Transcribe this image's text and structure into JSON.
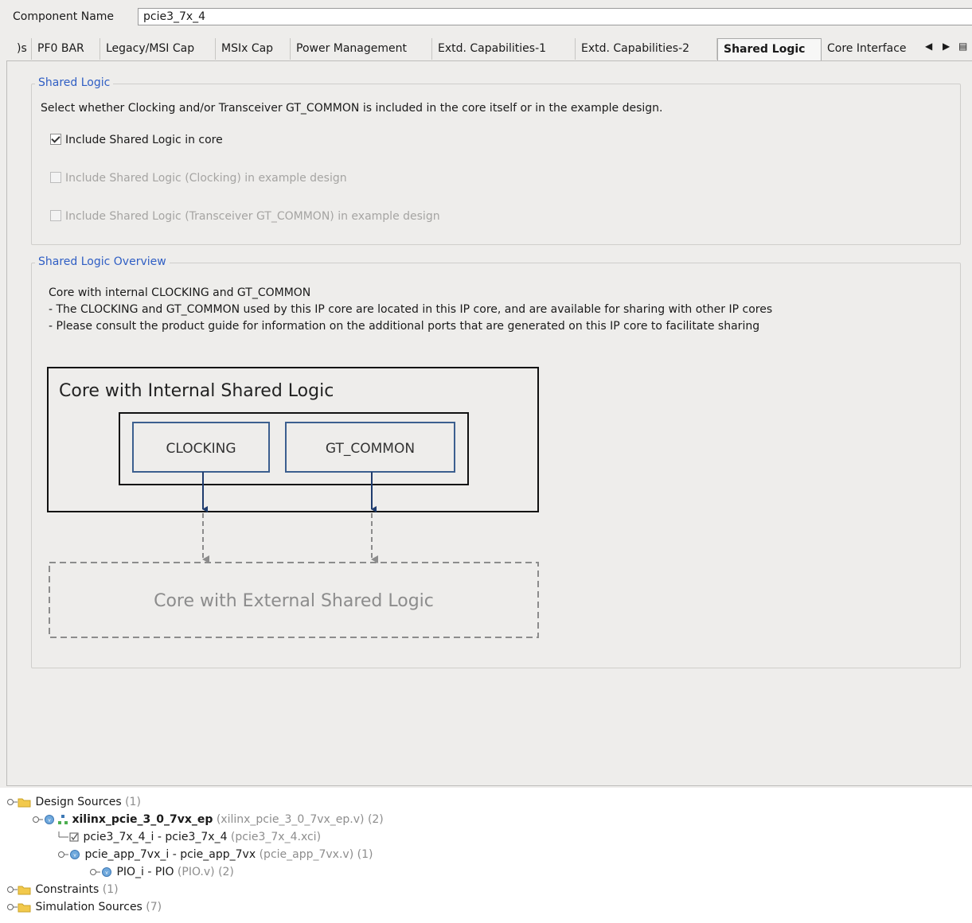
{
  "component": {
    "label": "Component Name",
    "value": "pcie3_7x_4"
  },
  "tabs": [
    {
      "label": ")s"
    },
    {
      "label": "PF0 BAR"
    },
    {
      "label": "Legacy/MSI Cap"
    },
    {
      "label": "MSIx Cap"
    },
    {
      "label": "Power Management"
    },
    {
      "label": "Extd. Capabilities-1"
    },
    {
      "label": "Extd. Capabilities-2"
    },
    {
      "label": "Shared Logic",
      "active": true
    },
    {
      "label": "Core Interface"
    }
  ],
  "shared_logic": {
    "title": "Shared Logic",
    "description": "Select whether Clocking and/or Transceiver GT_COMMON is included in the core itself or in the example design.",
    "options": [
      {
        "label": "Include Shared Logic in core",
        "checked": true,
        "enabled": true
      },
      {
        "label": "Include Shared Logic (Clocking) in example design",
        "checked": false,
        "enabled": false
      },
      {
        "label": "Include Shared Logic (Transceiver GT_COMMON) in example design",
        "checked": false,
        "enabled": false
      }
    ]
  },
  "overview": {
    "title": "Shared Logic Overview",
    "line1": "Core with internal CLOCKING and GT_COMMON",
    "line2": "- The CLOCKING and GT_COMMON used by this IP core are located in this IP core, and are available for sharing with other IP cores",
    "line3": "- Please consult the product guide for information on the additional ports that are generated on this IP core to facilitate sharing",
    "diagram": {
      "outer_title": "Core with Internal Shared Logic",
      "block1": "CLOCKING",
      "block2": "GT_COMMON",
      "external_title": "Core with External Shared Logic"
    }
  },
  "sources_tree": [
    {
      "label": "Design Sources",
      "suffix": " (1)",
      "icon": "folder-icon"
    },
    {
      "label": "xilinx_pcie_3_0_7vx_ep",
      "suffix": " (xilinx_pcie_3_0_7vx_ep.v) (2)",
      "icon": "verilog-top-icon",
      "bold": true
    },
    {
      "label": "pcie3_7x_4_i - pcie3_7x_4",
      "suffix": " (pcie3_7x_4.xci)",
      "icon": "ip-icon"
    },
    {
      "label": "pcie_app_7vx_i - pcie_app_7vx",
      "suffix": " (pcie_app_7vx.v) (1)",
      "icon": "verilog-icon"
    },
    {
      "label": "PIO_i - PIO",
      "suffix": " (PIO.v) (2)",
      "icon": "verilog-icon"
    },
    {
      "label": "Constraints",
      "suffix": " (1)",
      "icon": "folder-icon"
    },
    {
      "label": "Simulation Sources",
      "suffix": " (7)",
      "icon": "folder-icon"
    }
  ],
  "colors": {
    "panel_bg": "#eeedeb",
    "group_title": "#2f5ec4",
    "diagram_block_border": "#3c5f8f",
    "arrow_blue": "#1f3c6e",
    "dashed_gray": "#8c8c8c"
  }
}
